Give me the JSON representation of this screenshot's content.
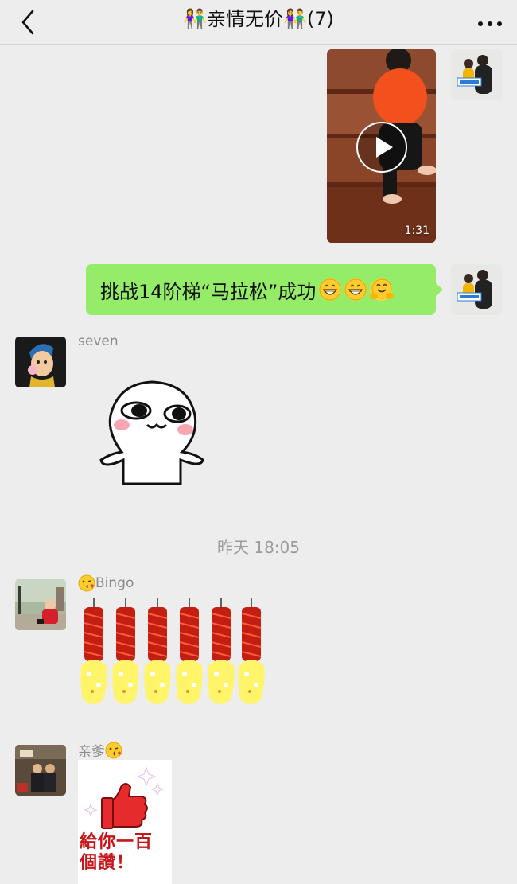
{
  "header": {
    "title": "👫亲情无价👫(7)",
    "back_icon": "chevron-left-icon",
    "more_icon": "more-dots-icon"
  },
  "messages": [
    {
      "type": "video",
      "direction": "outgoing",
      "duration": "1:31"
    },
    {
      "type": "text",
      "direction": "outgoing",
      "text": "挑战14阶梯“马拉松”成功"
    },
    {
      "type": "sticker",
      "direction": "incoming",
      "sender": "seven"
    },
    {
      "type": "timestamp",
      "text": "昨天 18:05"
    },
    {
      "type": "sticker",
      "direction": "incoming",
      "sender": "Bingo"
    },
    {
      "type": "sticker",
      "direction": "incoming",
      "sender": "亲爹",
      "sticker_text": "給你一百個讚！"
    }
  ],
  "colors": {
    "background": "#ededed",
    "bubble_outgoing": "#95ec69",
    "name_gray": "#8a8a8a"
  }
}
